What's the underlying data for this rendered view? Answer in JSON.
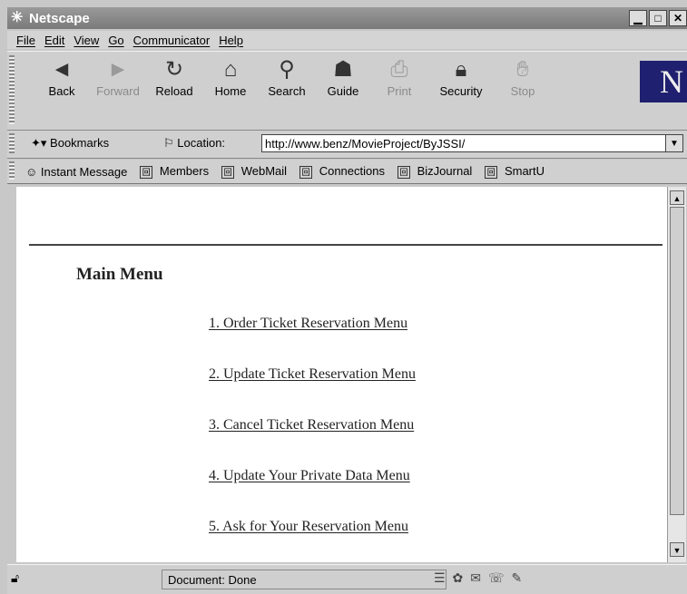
{
  "window": {
    "title": "Netscape",
    "controls": [
      "minimize",
      "maximize",
      "close"
    ]
  },
  "menubar": [
    "File",
    "Edit",
    "View",
    "Go",
    "Communicator",
    "Help"
  ],
  "toolbar": [
    {
      "label": "Back",
      "icon": "back-arrow-icon",
      "enabled": true
    },
    {
      "label": "Forward",
      "icon": "forward-arrow-icon",
      "enabled": false
    },
    {
      "label": "Reload",
      "icon": "reload-icon",
      "enabled": true
    },
    {
      "label": "Home",
      "icon": "home-icon",
      "enabled": true
    },
    {
      "label": "Search",
      "icon": "search-icon",
      "enabled": true
    },
    {
      "label": "Guide",
      "icon": "guide-icon",
      "enabled": true
    },
    {
      "label": "Print",
      "icon": "print-icon",
      "enabled": false
    },
    {
      "label": "Security",
      "icon": "security-icon",
      "enabled": true
    },
    {
      "label": "Stop",
      "icon": "stop-icon",
      "enabled": false
    }
  ],
  "location": {
    "bookmarks_label": "Bookmarks",
    "location_label": "Location:",
    "url": "http://www.benz/MovieProject/ByJSSI/"
  },
  "personal_toolbar": [
    "Instant Message",
    "Members",
    "WebMail",
    "Connections",
    "BizJournal",
    "SmartU"
  ],
  "page": {
    "title": "Main Menu",
    "links": [
      "1. Order Ticket Reservation Menu",
      "2. Update Ticket Reservation Menu",
      "3. Cancel Ticket Reservation Menu",
      "4. Update Your Private Data Menu",
      "5. Ask for Your Reservation Menu"
    ]
  },
  "status": {
    "message": "Document: Done"
  }
}
